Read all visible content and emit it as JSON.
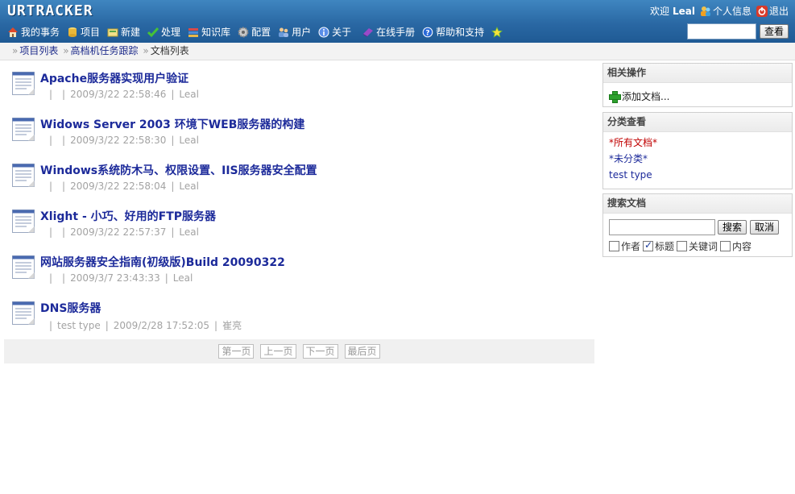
{
  "header": {
    "logo": "URTRACKER",
    "welcome": "欢迎",
    "username": "Leal",
    "profile": "个人信息",
    "logout": "退出",
    "search_button": "查看",
    "search_value": ""
  },
  "nav": [
    {
      "label": "我的事务",
      "icon": "home-icon"
    },
    {
      "label": "项目",
      "icon": "database-icon"
    },
    {
      "label": "新建",
      "icon": "new-icon"
    },
    {
      "label": "处理",
      "icon": "check-icon"
    },
    {
      "label": "知识库",
      "icon": "books-icon"
    },
    {
      "label": "配置",
      "icon": "gear-icon"
    },
    {
      "label": "用户",
      "icon": "users-icon"
    },
    {
      "label": "关于",
      "icon": "info-icon"
    },
    {
      "label": "在线手册",
      "icon": "manual-icon"
    },
    {
      "label": "帮助和支持",
      "icon": "help-icon"
    }
  ],
  "breadcrumb": {
    "items": [
      "项目列表",
      "高档机任务跟踪"
    ],
    "current": "文档列表"
  },
  "documents": [
    {
      "title": "Apache服务器实现用户验证",
      "type": "",
      "category": "",
      "date": "2009/3/22 22:58:46",
      "author": "Leal"
    },
    {
      "title": "Widows Server 2003 环境下WEB服务器的构建",
      "type": "",
      "category": "",
      "date": "2009/3/22 22:58:30",
      "author": "Leal"
    },
    {
      "title": "Windows系统防木马、权限设置、IIS服务器安全配置",
      "type": "",
      "category": "",
      "date": "2009/3/22 22:58:04",
      "author": "Leal"
    },
    {
      "title": "Xlight - 小巧、好用的FTP服务器",
      "type": "",
      "category": "",
      "date": "2009/3/22 22:57:37",
      "author": "Leal"
    },
    {
      "title": "网站服务器安全指南(初级版)Build 20090322",
      "type": "",
      "category": "",
      "date": "2009/3/7 23:43:33",
      "author": "Leal"
    },
    {
      "title": "DNS服务器",
      "type": "",
      "category": "test type",
      "date": "2009/2/28 17:52:05",
      "author": "崔亮"
    }
  ],
  "pager": {
    "first": "第一页",
    "prev": "上一页",
    "next": "下一页",
    "last": "最后页"
  },
  "sidebar": {
    "actions": {
      "title": "相关操作",
      "add_doc": "添加文档..."
    },
    "categories": {
      "title": "分类查看",
      "items": [
        "*所有文档*",
        "*未分类*",
        "test type"
      ],
      "active_index": 0
    },
    "search": {
      "title": "搜索文档",
      "value": "",
      "search_button": "搜索",
      "cancel_button": "取消",
      "options": [
        {
          "label": "作者",
          "checked": false
        },
        {
          "label": "标题",
          "checked": true
        },
        {
          "label": "关键词",
          "checked": false
        },
        {
          "label": "内容",
          "checked": false
        }
      ]
    }
  },
  "colors": {
    "header": "#2a68a4",
    "link": "#1c2a9a",
    "active_category": "#c00000",
    "meta": "#a3a3a3"
  }
}
